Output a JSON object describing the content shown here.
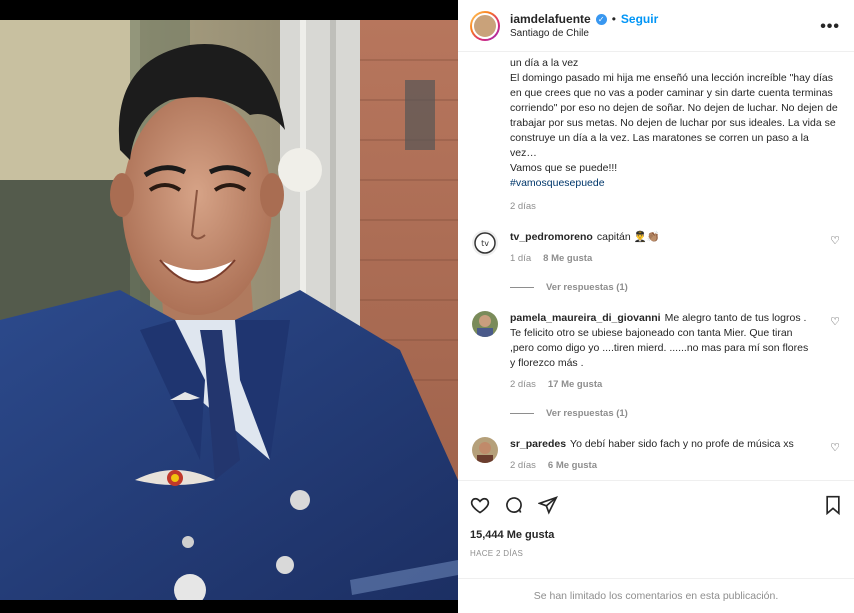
{
  "post": {
    "username": "iamdelafuente",
    "follow_label": "Seguir",
    "separator": "•",
    "location": "Santiago de Chile",
    "more_label": "•••"
  },
  "caption": {
    "text": "un día a la vez\nEl domingo pasado mi hija me enseñó una lección increíble \"hay días en que crees que no vas a poder caminar y sin darte cuenta terminas corriendo\" por eso no dejen de soñar. No dejen de luchar. No dejen de trabajar por sus metas. No dejen de luchar por sus ideales. La vida se construye un día a la vez. Las maratones se corren un paso a la vez…\nVamos que se puede!!!",
    "hashtag": "#vamosquesepuede",
    "time": "2 días"
  },
  "comments": [
    {
      "user": "tv_pedromoreno",
      "text": "capitán 👨‍✈️👏🏽",
      "time": "1 día",
      "likes": "8 Me gusta",
      "replies": "Ver respuestas (1)"
    },
    {
      "user": "pamela_maureira_di_giovanni",
      "text": "Me alegro tanto de tus logros . Te felicito otro se ubiese bajoneado con tanta Mier. Que tiran ,pero como digo yo ....tiren mierd. ......no mas para mí son flores y florezco más .",
      "time": "2 días",
      "likes": "17 Me gusta",
      "replies": "Ver respuestas (1)"
    },
    {
      "user": "sr_paredes",
      "text": "Yo debí haber sido fach y no profe de música xs",
      "time": "2 días",
      "likes": "6 Me gusta"
    }
  ],
  "stats": {
    "likes": "15,444 Me gusta",
    "date": "HACE 2 DÍAS"
  },
  "footer": {
    "limited": "Se han limitado los comentarios en esta publicación."
  },
  "icons": {
    "like": "heart-icon",
    "comment": "comment-icon",
    "share": "share-icon",
    "save": "bookmark-icon",
    "verified": "verified-badge-icon"
  },
  "colors": {
    "accent": "#0095f6",
    "verified": "#3897f0",
    "muted": "#8e8e8e",
    "hashtag": "#00376b"
  }
}
